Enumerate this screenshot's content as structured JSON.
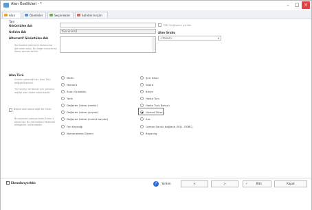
{
  "window": {
    "title": "Alan Özellikleri - *"
  },
  "tabs": [
    {
      "label": "Alan Tanı"
    },
    {
      "label": "Özellikler"
    },
    {
      "label": "Seçenekler"
    },
    {
      "label": "Sahiller Erişim"
    }
  ],
  "form": {
    "display_name_label": "Görüntülen Adı",
    "display_name_value": "",
    "field_name_label": "Gelirim Adı",
    "field_name_value": "fGorünüm1",
    "alt_display_label": "Alternatif Görüntülen Adı",
    "alt_display_note": "Sizi kontrol ederseniz kullanıcılar görünüm adını, Bu değer kullanılırsa alana sonrası belirlir.",
    "tbm_label": "TBM Değişkeni gizlidir",
    "field_group_label": "Alan Grubu",
    "field_group_value": "<Yoksa>"
  },
  "field_type": {
    "label": "Alan Türü",
    "note1": "Ürünün göreceği tipi. Alan Türü değişikliklerinizi.",
    "note2": "Yeri seçtiyi verileriniz için yalnızca seçtiği alan tipleri kullanılabilir.",
    "dep_label": "Başvurulan alana bağlı bir Eklen",
    "dep_note": "Bu seçenek ardında kalan Eklen 1 ekrok tipi. Bu Görüntülen fitrelerde eklegecek. kullanılabilir.",
    "options_left": [
      "Metin",
      "Numara",
      "Sure (Ürüdelik)",
      "Tarih",
      "Değerler Listesi (metin)",
      "Değerler Listesi (sayılar)",
      "Değerler Listesi (kırıklık sayılar)",
      "Fon Kaynağı",
      "Numaralama Düzeni"
    ],
    "options_right": [
      "Şirü İkkon",
      "Kapra",
      "Birçm",
      "Hasta Turu",
      "Hasta Tipi (Bahçe)",
      "Hizmet Sürer",
      "Ara",
      "Uzman Sorulu bağlantı (SQL, ODBC)",
      "Başarılıg"
    ],
    "selected": "Hizmet Sürer"
  },
  "footer": {
    "advanced_label": "Ekranlarıyorlıklı",
    "help": "?",
    "yardim": "Yardım",
    "prev": "<",
    "next": ">",
    "ok": "Bitir",
    "cancel": "Kapat"
  }
}
